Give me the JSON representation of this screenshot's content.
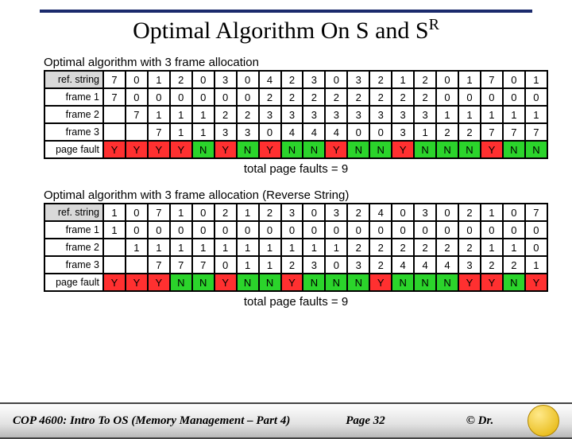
{
  "title_html": "Optimal Algorithm On S and S<sup>R</sup>",
  "footer": {
    "course": "COP 4600: Intro To OS  (Memory Management – Part 4)",
    "page": "Page 32",
    "copy": "© Dr."
  },
  "total_label": "total page faults = 9",
  "table1": {
    "caption": "Optimal algorithm with 3 frame allocation",
    "rows": {
      "ref": [
        "7",
        "0",
        "1",
        "2",
        "0",
        "3",
        "0",
        "4",
        "2",
        "3",
        "0",
        "3",
        "2",
        "1",
        "2",
        "0",
        "1",
        "7",
        "0",
        "1"
      ],
      "frame1": [
        "7",
        "0",
        "0",
        "0",
        "0",
        "0",
        "0",
        "2",
        "2",
        "2",
        "2",
        "2",
        "2",
        "2",
        "2",
        "0",
        "0",
        "0",
        "0",
        "0"
      ],
      "frame2": [
        "",
        "7",
        "1",
        "1",
        "1",
        "2",
        "2",
        "3",
        "3",
        "3",
        "3",
        "3",
        "3",
        "3",
        "3",
        "1",
        "1",
        "1",
        "1",
        "1"
      ],
      "frame3": [
        "",
        "",
        "7",
        "1",
        "1",
        "3",
        "3",
        "0",
        "4",
        "4",
        "4",
        "0",
        "0",
        "3",
        "1",
        "2",
        "2",
        "7",
        "7",
        "7"
      ],
      "fault": [
        "Y",
        "Y",
        "Y",
        "Y",
        "N",
        "Y",
        "N",
        "Y",
        "N",
        "N",
        "Y",
        "N",
        "N",
        "Y",
        "N",
        "N",
        "N",
        "Y",
        "N",
        "N"
      ]
    }
  },
  "table2": {
    "caption": "Optimal algorithm with 3 frame allocation (Reverse String)",
    "rows": {
      "ref": [
        "1",
        "0",
        "7",
        "1",
        "0",
        "2",
        "1",
        "2",
        "3",
        "0",
        "3",
        "2",
        "4",
        "0",
        "3",
        "0",
        "2",
        "1",
        "0",
        "7"
      ],
      "frame1": [
        "1",
        "0",
        "0",
        "0",
        "0",
        "0",
        "0",
        "0",
        "0",
        "0",
        "0",
        "0",
        "0",
        "0",
        "0",
        "0",
        "0",
        "0",
        "0",
        "0"
      ],
      "frame2": [
        "",
        "1",
        "1",
        "1",
        "1",
        "1",
        "1",
        "1",
        "1",
        "1",
        "1",
        "2",
        "2",
        "2",
        "2",
        "2",
        "2",
        "1",
        "1",
        "0"
      ],
      "frame3": [
        "",
        "",
        "7",
        "7",
        "7",
        "0",
        "1",
        "1",
        "2",
        "3",
        "0",
        "3",
        "2",
        "4",
        "4",
        "4",
        "3",
        "2",
        "2",
        "1"
      ],
      "fault": [
        "Y",
        "Y",
        "Y",
        "N",
        "N",
        "Y",
        "N",
        "N",
        "Y",
        "N",
        "N",
        "N",
        "Y",
        "N",
        "N",
        "N",
        "Y",
        "Y",
        "N",
        "Y"
      ]
    }
  },
  "row_labels": {
    "ref": "ref. string",
    "frame1": "frame 1",
    "frame2": "frame 2",
    "frame3": "frame 3",
    "fault": "page fault"
  }
}
